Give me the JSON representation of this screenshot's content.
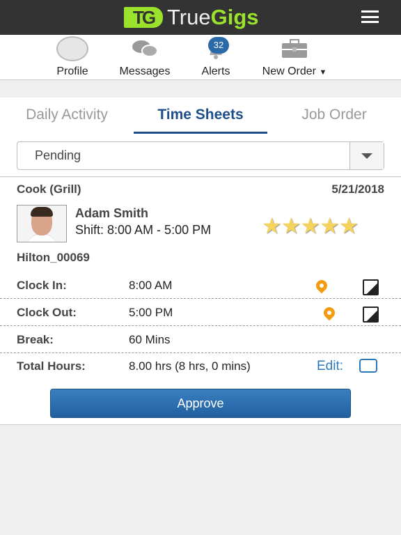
{
  "header": {
    "logo_mark": "TG",
    "logo_text_1": "True",
    "logo_text_2": "Gigs",
    "menu_icon": "hamburger-icon"
  },
  "nav": [
    {
      "label": "Profile",
      "icon": "avatar-icon"
    },
    {
      "label": "Messages",
      "icon": "chat-bubbles-icon"
    },
    {
      "label": "Alerts",
      "icon": "bell-icon",
      "badge": "32"
    },
    {
      "label": "New Order",
      "icon": "briefcase-icon"
    }
  ],
  "tabs": [
    {
      "label": "Daily Activity"
    },
    {
      "label": "Time Sheets",
      "active": true
    },
    {
      "label": "Job Order"
    }
  ],
  "filter": {
    "value": "Pending"
  },
  "timesheet": {
    "job": "Cook (Grill)",
    "date": "5/21/2018",
    "name": "Adam Smith",
    "shift": "Shift: 8:00 AM - 5:00 PM",
    "rating": 5,
    "stars": "★★★★★",
    "order_id": "Hilton_00069",
    "rows": [
      {
        "label": "Clock In:",
        "value": "8:00 AM"
      },
      {
        "label": "Clock Out:",
        "value": "5:00 PM"
      },
      {
        "label": "Break:",
        "value": "60 Mins"
      },
      {
        "label": "Total Hours:",
        "value": "8.00 hrs (8 hrs, 0 mins)"
      }
    ],
    "edit_label": "Edit:",
    "approve_label": "Approve"
  },
  "colors": {
    "header": "#333333",
    "logo_green": "#9be22d",
    "accent_blue": "#1d4f8c",
    "pin": "#f39c12",
    "badge": "#2a6aa8"
  }
}
